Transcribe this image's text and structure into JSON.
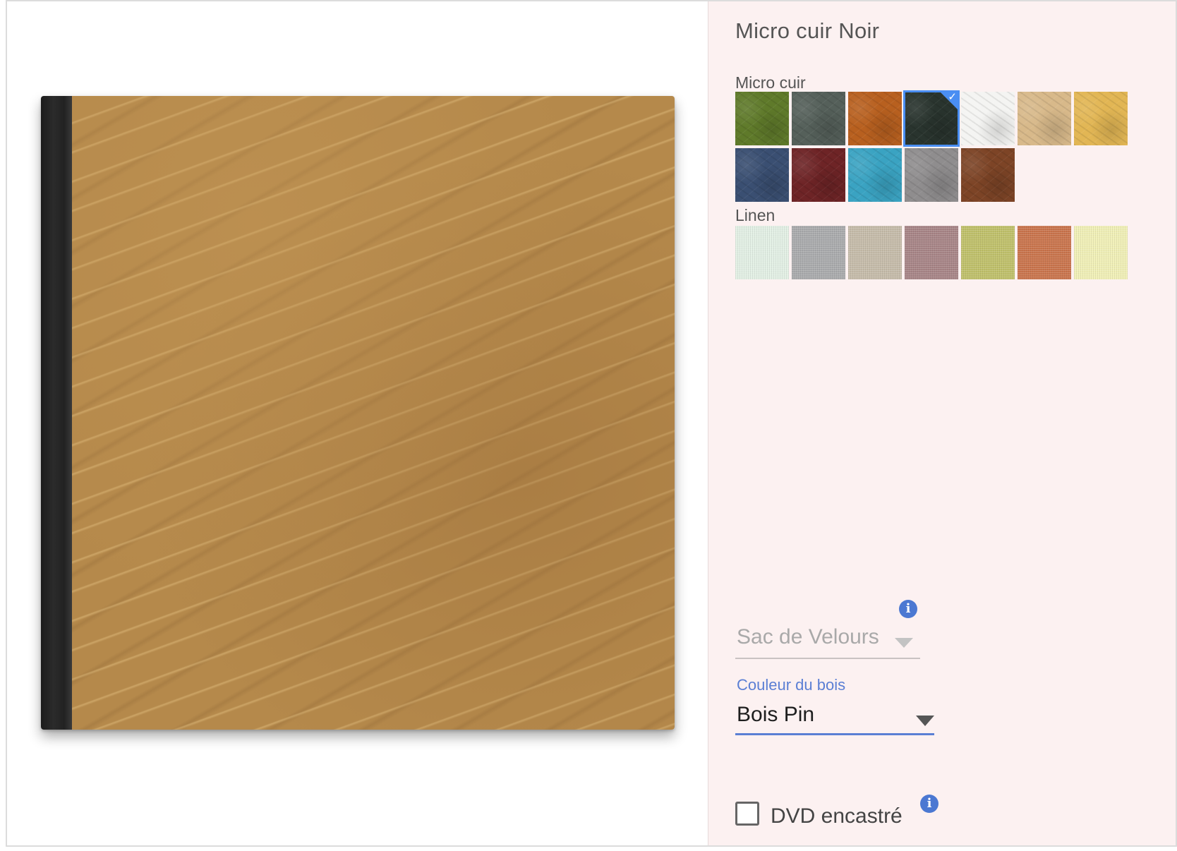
{
  "preview": {
    "spine_color": "#222222",
    "cover_material": "Bois Pin"
  },
  "sidebar": {
    "title": "Micro cuir Noir",
    "micro_cuir": {
      "label": "Micro cuir",
      "swatches": [
        {
          "name": "green",
          "color": "#5f7a2a"
        },
        {
          "name": "dark-grey",
          "color": "#55605a"
        },
        {
          "name": "orange",
          "color": "#b8601f"
        },
        {
          "name": "black",
          "color": "#29342e",
          "selected": true
        },
        {
          "name": "white",
          "color": "#f4f4f2"
        },
        {
          "name": "beige",
          "color": "#d8b98a"
        },
        {
          "name": "yellow",
          "color": "#e2b654"
        },
        {
          "name": "navy",
          "color": "#3a4f72"
        },
        {
          "name": "burgundy",
          "color": "#6e2426"
        },
        {
          "name": "turquoise",
          "color": "#3aa3c2"
        },
        {
          "name": "grey",
          "color": "#8f8d8e"
        },
        {
          "name": "brown",
          "color": "#7d4426"
        }
      ]
    },
    "linen": {
      "label": "Linen",
      "swatches": [
        {
          "name": "mint",
          "color": "#e2efe4"
        },
        {
          "name": "silver",
          "color": "#a9aaac"
        },
        {
          "name": "sand",
          "color": "#c5bba9"
        },
        {
          "name": "mauve",
          "color": "#a78486"
        },
        {
          "name": "lime",
          "color": "#bfc06a"
        },
        {
          "name": "terracotta",
          "color": "#c9744c"
        },
        {
          "name": "cream",
          "color": "#f0efb6"
        }
      ]
    },
    "sac_de_velours": {
      "value": "Sac de Velours"
    },
    "couleur_du_bois": {
      "label": "Couleur du bois",
      "value": "Bois Pin"
    },
    "dvd": {
      "label": "DVD encastré",
      "checked": false
    },
    "colors": {
      "accent": "#4a8ef2",
      "info_icon": "#4b78d2",
      "select_underline_active": "#5b7fd4",
      "sidebar_bg": "#fcf1f1"
    }
  }
}
